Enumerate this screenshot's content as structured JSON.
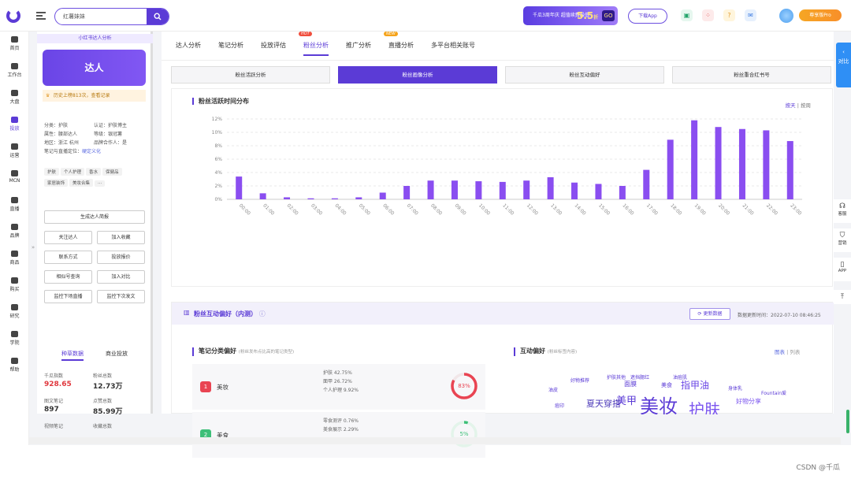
{
  "topbar": {
    "search_value": "红薯妹妹",
    "banner_text": "千瓜3周年庆 超值续费最低",
    "banner_discount": "5.5",
    "banner_discount_unit": "折",
    "banner_go": "GO",
    "download_app": "下载App",
    "pro_label": "尊享版Pro"
  },
  "leftnav": [
    "首页",
    "工作台",
    "大盘",
    "投放",
    "运营",
    "MCN",
    "直播",
    "品牌",
    "商品",
    "购买",
    "研究",
    "学院",
    "帮助"
  ],
  "profile": {
    "header": "小红书达人分析",
    "card_title": "达人",
    "history": "历史上榜813次，查看记录",
    "info": [
      [
        "分类：护肤",
        "认证：护肤博主"
      ],
      [
        "属性：腰部达人",
        "等级：银冠薯"
      ],
      [
        "地区：浙江 杭州",
        "品牌合作人：是"
      ]
    ],
    "live_label": "笔记与直播定位：",
    "live_value": "硬定义化",
    "tags": [
      "护肤",
      "个人护理",
      "香水",
      "保健品",
      "家居装饰",
      "美妆合集",
      "···"
    ],
    "buttons": [
      "生成达人简报",
      "关注达人",
      "加入收藏",
      "联系方式",
      "投放报价",
      "相似号查询",
      "加入对比",
      "监控下场直播",
      "监控下次发文"
    ],
    "tabs": [
      "种草数据",
      "商业投放"
    ],
    "stats": [
      {
        "label": "千瓜指数",
        "value": "928.65"
      },
      {
        "label": "粉丝总数",
        "value": "12.73万"
      },
      {
        "label": "图文笔记",
        "value": "897"
      },
      {
        "label": "点赞总数",
        "value": "85.99万"
      },
      {
        "label": "视频笔记",
        "value": ""
      },
      {
        "label": "收藏总数",
        "value": ""
      }
    ]
  },
  "tabs": [
    {
      "label": "达人分析",
      "badge": ""
    },
    {
      "label": "笔记分析",
      "badge": ""
    },
    {
      "label": "投放评估",
      "badge": ""
    },
    {
      "label": "粉丝分析",
      "badge": "HOT"
    },
    {
      "label": "推广分析",
      "badge": ""
    },
    {
      "label": "直播分析",
      "badge": "NEW"
    },
    {
      "label": "多平台相关账号",
      "badge": ""
    }
  ],
  "subtabs": [
    "粉丝活跃分析",
    "粉丝画像分析",
    "粉丝互动偏好",
    "粉丝重合红书号"
  ],
  "chart_section": {
    "title": "粉丝活跃时间分布",
    "toggle_day": "按天",
    "toggle_week": "按周"
  },
  "chart_data": {
    "type": "bar",
    "title": "粉丝活跃时间分布",
    "xlabel": "",
    "ylabel": "",
    "ylim": [
      0,
      12
    ],
    "yticks": [
      "0%",
      "2%",
      "4%",
      "6%",
      "8%",
      "10%",
      "12%"
    ],
    "categories": [
      "00:00",
      "01:00",
      "02:00",
      "03:00",
      "04:00",
      "05:00",
      "06:00",
      "07:00",
      "08:00",
      "09:00",
      "10:00",
      "11:00",
      "12:00",
      "13:00",
      "14:00",
      "15:00",
      "16:00",
      "17:00",
      "18:00",
      "19:00",
      "20:00",
      "21:00",
      "22:00",
      "23:00"
    ],
    "values": [
      3.4,
      0.9,
      0.3,
      0.15,
      0.15,
      0.3,
      1.0,
      2.0,
      2.8,
      2.8,
      2.7,
      2.6,
      2.8,
      3.3,
      2.5,
      2.3,
      2.0,
      4.4,
      8.9,
      11.8,
      10.8,
      10.5,
      10.3,
      8.7
    ],
    "unit": "%"
  },
  "interaction": {
    "title": "粉丝互动偏好（内测）",
    "update_btn": "更新数据",
    "update_time": "数据更新时间：2022-07-10 08:46:25",
    "cat_title": "笔记分类偏好",
    "cat_note": "(粉丝发布点比高的笔记类型)",
    "pref_title": "互动偏好",
    "pref_note": "(粉丝标签内容)",
    "view_chart": "图表",
    "view_list": "列表",
    "categories": [
      {
        "rank": "1",
        "name": "美妆",
        "details": [
          "护肤 42.75%",
          "面甲 26.72%",
          "个人护理 9.92%"
        ],
        "percent": "83%",
        "ratio": 0.83
      },
      {
        "rank": "2",
        "name": "美食",
        "details": [
          "零食测评 0.76%",
          "美食展示 2.29%"
        ],
        "percent": "5%",
        "ratio": 0.05
      }
    ],
    "words": [
      "美妆",
      "护肤",
      "指甲油",
      "美甲",
      "夏天穿搭",
      "面膜",
      "好物推荐",
      "护肤其他",
      "遮挡腮红",
      "油皮",
      "油痘肌",
      "身体乳",
      "美食",
      "好物分享",
      "Fountain爱",
      "痘印"
    ]
  },
  "rightdock": {
    "compare": "对比",
    "items": [
      "客服",
      "营销",
      "APP"
    ]
  },
  "watermark": "CSDN @千瓜"
}
